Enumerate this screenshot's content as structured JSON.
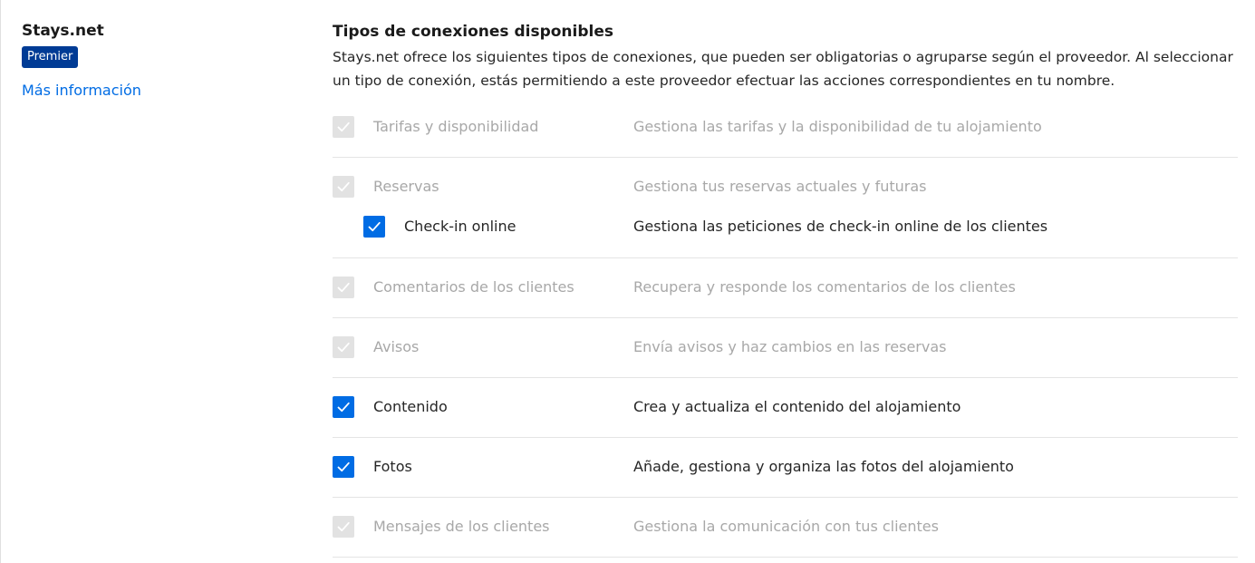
{
  "provider": {
    "name": "Stays.net",
    "badge": "Premier",
    "more_link": "Más información"
  },
  "section": {
    "title": "Tipos de conexiones disponibles",
    "description": "Stays.net ofrece los siguientes tipos de conexiones, que pueden ser obligatorias o agruparse según el proveedor. Al seleccionar un tipo de conexión, estás permitiendo a este proveedor efectuar las acciones correspondientes en tu nombre."
  },
  "connections": [
    {
      "label": "Tarifas y disponibilidad",
      "description": "Gestiona las tarifas y la disponibilidad de tu alojamiento",
      "checked": true,
      "disabled": true
    },
    {
      "label": "Reservas",
      "description": "Gestiona tus reservas actuales y futuras",
      "checked": true,
      "disabled": true
    },
    {
      "label": "Check-in online",
      "description": "Gestiona las peticiones de check-in online de los clientes",
      "checked": true,
      "disabled": false
    },
    {
      "label": "Comentarios de los clientes",
      "description": "Recupera y responde los comentarios de los clientes",
      "checked": true,
      "disabled": true
    },
    {
      "label": "Avisos",
      "description": "Envía avisos y haz cambios en las reservas",
      "checked": true,
      "disabled": true
    },
    {
      "label": "Contenido",
      "description": "Crea y actualiza el contenido del alojamiento",
      "checked": true,
      "disabled": false
    },
    {
      "label": "Fotos",
      "description": "Añade, gestiona y organiza las fotos del alojamiento",
      "checked": true,
      "disabled": false
    },
    {
      "label": "Mensajes de los clientes",
      "description": "Gestiona la comunicación con tus clientes",
      "checked": true,
      "disabled": true
    }
  ],
  "colors": {
    "accent": "#006ce4",
    "badge": "#003b95",
    "disabled_checkbox": "#e2e2e2",
    "muted_text": "#a8a8a8"
  }
}
